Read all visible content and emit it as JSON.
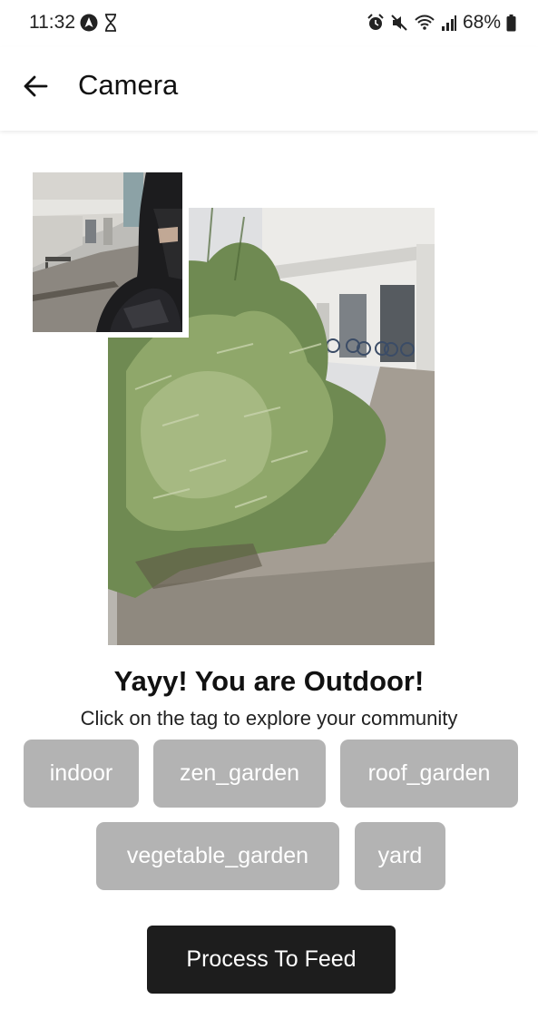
{
  "status_bar": {
    "time": "11:32",
    "battery": "68%",
    "left_icons": [
      "navigation-circle-icon",
      "hourglass-icon"
    ],
    "right_icons": [
      "alarm-icon",
      "mute-icon",
      "wifi-icon",
      "signal-icon",
      "battery-icon"
    ]
  },
  "app_bar": {
    "title": "Camera",
    "back_icon": "arrow-left-icon"
  },
  "result": {
    "title": "Yayy! You are Outdoor!",
    "subtitle": "Click on the tag to explore your community"
  },
  "tags": [
    "indoor",
    "zen_garden",
    "roof_garden",
    "vegetable_garden",
    "yard"
  ],
  "process_button": "Process To Feed",
  "colors": {
    "tag_bg": "#b3b3b3",
    "button_bg": "#1d1d1d",
    "text": "#111111"
  }
}
